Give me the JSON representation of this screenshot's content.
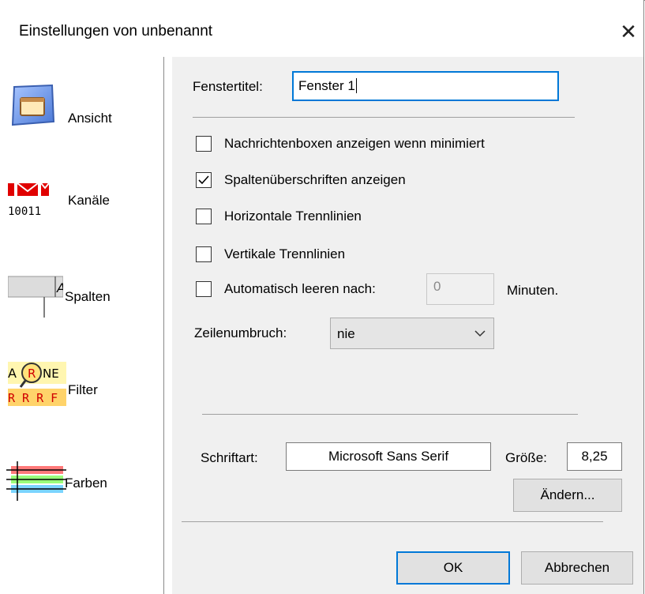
{
  "window": {
    "title": "Einstellungen von unbenannt",
    "close_glyph": "✕"
  },
  "sidebar": {
    "items": [
      {
        "label": "Ansicht",
        "icon": "window-view-icon"
      },
      {
        "label": "Kanäle",
        "icon": "mail-channels-icon",
        "icon_text": "10011"
      },
      {
        "label": "Spalten",
        "icon": "columns-icon",
        "icon_text": "A"
      },
      {
        "label": "Filter",
        "icon": "filter-magnifier-icon",
        "icon_text_top": "A",
        "icon_text_mid": "R",
        "icon_text_right": "NE",
        "icon_text_bottom": "R R R F"
      },
      {
        "label": "Farben",
        "icon": "color-lines-icon"
      }
    ]
  },
  "view": {
    "window_title_label": "Fenstertitel:",
    "window_title_value": "Fenster 1",
    "checkboxes": [
      {
        "label": "Nachrichtenboxen anzeigen wenn minimiert",
        "checked": false
      },
      {
        "label": "Spaltenüberschriften anzeigen",
        "checked": true
      },
      {
        "label": "Horizontale Trennlinien",
        "checked": false
      },
      {
        "label": "Vertikale Trennlinien",
        "checked": false
      },
      {
        "label": "Automatisch leeren nach:",
        "checked": false
      }
    ],
    "auto_clear_value": "0",
    "auto_clear_unit": "Minuten.",
    "wrap_label": "Zeilenumbruch:",
    "wrap_value": "nie",
    "font_label": "Schriftart:",
    "font_value": "Microsoft Sans Serif",
    "size_label": "Größe:",
    "size_value": "8,25",
    "change_button": "Ändern..."
  },
  "footer": {
    "ok": "OK",
    "cancel": "Abbrechen"
  },
  "colors": {
    "accent": "#0078d7",
    "panel": "#f0f0f0"
  }
}
